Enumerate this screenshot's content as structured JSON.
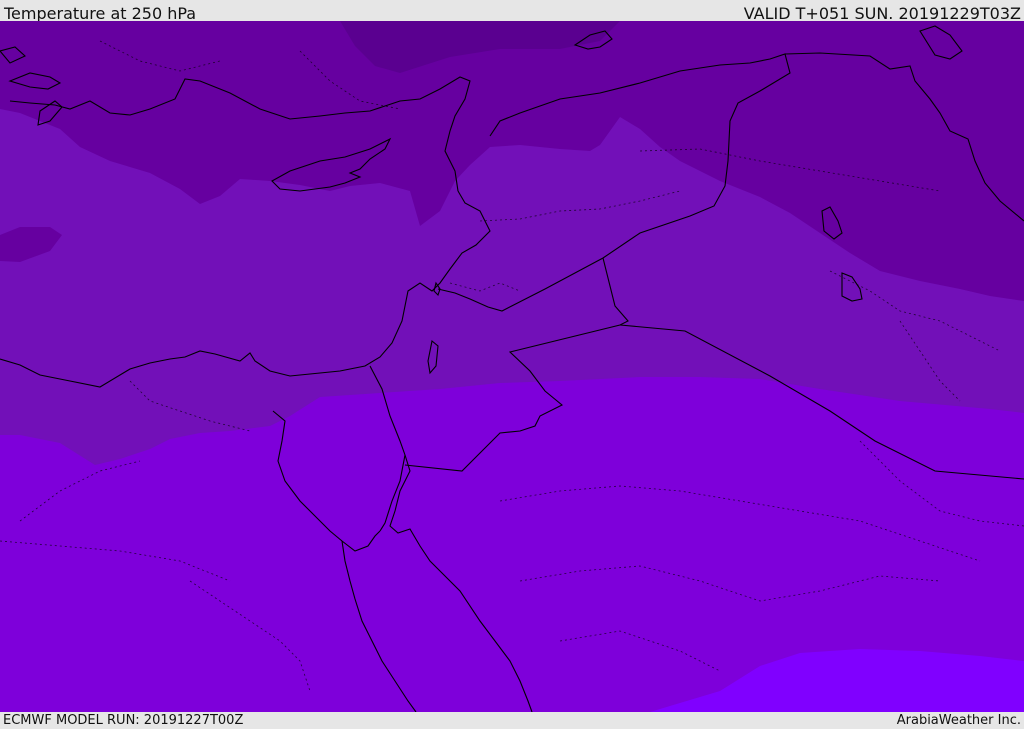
{
  "header": {
    "title": "Temperature at 250 hPa",
    "valid": "VALID T+051 SUN. 20191229T03Z"
  },
  "footer": {
    "model_run": "ECMWF MODEL RUN: 20191227T00Z",
    "brand": "ArabiaWeather Inc."
  },
  "map": {
    "colors": {
      "darkest": "#5a0090",
      "dark": "#6600a0",
      "medium": "#7210b8",
      "bright": "#7e00da",
      "brightest": "#8000ff"
    }
  }
}
